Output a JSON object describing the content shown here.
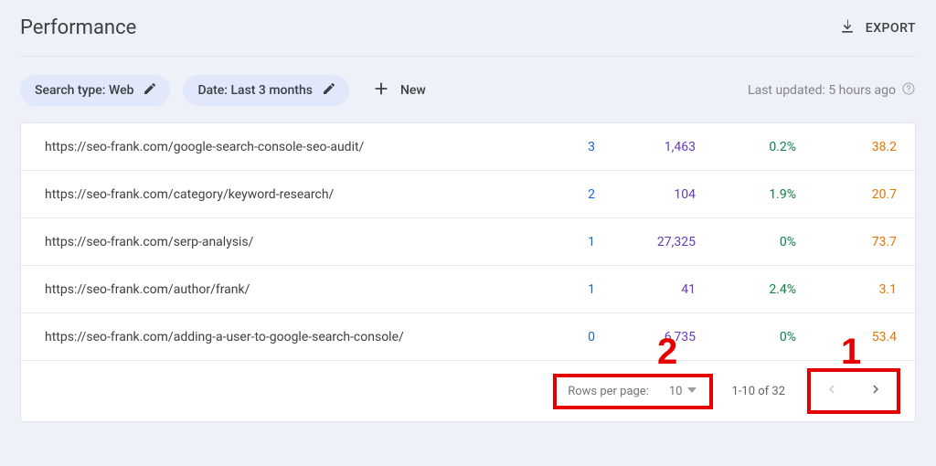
{
  "header": {
    "title": "Performance",
    "export_label": "EXPORT"
  },
  "filters": {
    "search_type_label": "Search type: Web",
    "date_label": "Date: Last 3 months",
    "new_label": "New",
    "last_updated": "Last updated: 5 hours ago"
  },
  "columns": {
    "clicks_color": "#1967d2",
    "impressions_color": "#673ab7",
    "ctr_color": "#0b8043",
    "position_color": "#e37400"
  },
  "rows": [
    {
      "url": "https://seo-frank.com/google-search-console-seo-audit/",
      "clicks": "3",
      "impressions": "1,463",
      "ctr": "0.2%",
      "position": "38.2"
    },
    {
      "url": "https://seo-frank.com/category/keyword-research/",
      "clicks": "2",
      "impressions": "104",
      "ctr": "1.9%",
      "position": "20.7"
    },
    {
      "url": "https://seo-frank.com/serp-analysis/",
      "clicks": "1",
      "impressions": "27,325",
      "ctr": "0%",
      "position": "73.7"
    },
    {
      "url": "https://seo-frank.com/author/frank/",
      "clicks": "1",
      "impressions": "41",
      "ctr": "2.4%",
      "position": "3.1"
    },
    {
      "url": "https://seo-frank.com/adding-a-user-to-google-search-console/",
      "clicks": "0",
      "impressions": "6,735",
      "ctr": "0%",
      "position": "53.4"
    }
  ],
  "pagination": {
    "rows_per_page_label": "Rows per page:",
    "rows_per_page_value": "10",
    "range": "1-10 of 32"
  },
  "annotations": {
    "label1": "1",
    "label2": "2"
  }
}
